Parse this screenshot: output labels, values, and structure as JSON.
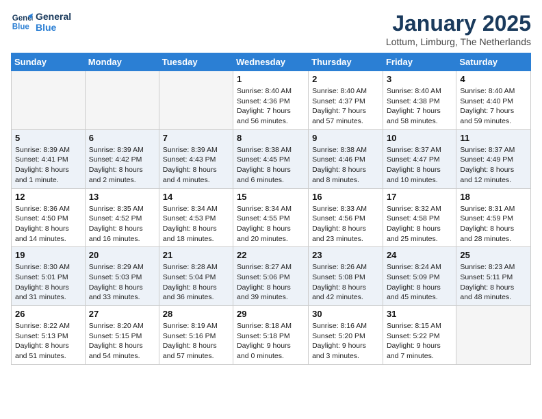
{
  "logo": {
    "line1": "General",
    "line2": "Blue"
  },
  "title": "January 2025",
  "subtitle": "Lottum, Limburg, The Netherlands",
  "weekdays": [
    "Sunday",
    "Monday",
    "Tuesday",
    "Wednesday",
    "Thursday",
    "Friday",
    "Saturday"
  ],
  "weeks": [
    [
      {
        "day": "",
        "info": ""
      },
      {
        "day": "",
        "info": ""
      },
      {
        "day": "",
        "info": ""
      },
      {
        "day": "1",
        "info": "Sunrise: 8:40 AM\nSunset: 4:36 PM\nDaylight: 7 hours\nand 56 minutes."
      },
      {
        "day": "2",
        "info": "Sunrise: 8:40 AM\nSunset: 4:37 PM\nDaylight: 7 hours\nand 57 minutes."
      },
      {
        "day": "3",
        "info": "Sunrise: 8:40 AM\nSunset: 4:38 PM\nDaylight: 7 hours\nand 58 minutes."
      },
      {
        "day": "4",
        "info": "Sunrise: 8:40 AM\nSunset: 4:40 PM\nDaylight: 7 hours\nand 59 minutes."
      }
    ],
    [
      {
        "day": "5",
        "info": "Sunrise: 8:39 AM\nSunset: 4:41 PM\nDaylight: 8 hours\nand 1 minute."
      },
      {
        "day": "6",
        "info": "Sunrise: 8:39 AM\nSunset: 4:42 PM\nDaylight: 8 hours\nand 2 minutes."
      },
      {
        "day": "7",
        "info": "Sunrise: 8:39 AM\nSunset: 4:43 PM\nDaylight: 8 hours\nand 4 minutes."
      },
      {
        "day": "8",
        "info": "Sunrise: 8:38 AM\nSunset: 4:45 PM\nDaylight: 8 hours\nand 6 minutes."
      },
      {
        "day": "9",
        "info": "Sunrise: 8:38 AM\nSunset: 4:46 PM\nDaylight: 8 hours\nand 8 minutes."
      },
      {
        "day": "10",
        "info": "Sunrise: 8:37 AM\nSunset: 4:47 PM\nDaylight: 8 hours\nand 10 minutes."
      },
      {
        "day": "11",
        "info": "Sunrise: 8:37 AM\nSunset: 4:49 PM\nDaylight: 8 hours\nand 12 minutes."
      }
    ],
    [
      {
        "day": "12",
        "info": "Sunrise: 8:36 AM\nSunset: 4:50 PM\nDaylight: 8 hours\nand 14 minutes."
      },
      {
        "day": "13",
        "info": "Sunrise: 8:35 AM\nSunset: 4:52 PM\nDaylight: 8 hours\nand 16 minutes."
      },
      {
        "day": "14",
        "info": "Sunrise: 8:34 AM\nSunset: 4:53 PM\nDaylight: 8 hours\nand 18 minutes."
      },
      {
        "day": "15",
        "info": "Sunrise: 8:34 AM\nSunset: 4:55 PM\nDaylight: 8 hours\nand 20 minutes."
      },
      {
        "day": "16",
        "info": "Sunrise: 8:33 AM\nSunset: 4:56 PM\nDaylight: 8 hours\nand 23 minutes."
      },
      {
        "day": "17",
        "info": "Sunrise: 8:32 AM\nSunset: 4:58 PM\nDaylight: 8 hours\nand 25 minutes."
      },
      {
        "day": "18",
        "info": "Sunrise: 8:31 AM\nSunset: 4:59 PM\nDaylight: 8 hours\nand 28 minutes."
      }
    ],
    [
      {
        "day": "19",
        "info": "Sunrise: 8:30 AM\nSunset: 5:01 PM\nDaylight: 8 hours\nand 31 minutes."
      },
      {
        "day": "20",
        "info": "Sunrise: 8:29 AM\nSunset: 5:03 PM\nDaylight: 8 hours\nand 33 minutes."
      },
      {
        "day": "21",
        "info": "Sunrise: 8:28 AM\nSunset: 5:04 PM\nDaylight: 8 hours\nand 36 minutes."
      },
      {
        "day": "22",
        "info": "Sunrise: 8:27 AM\nSunset: 5:06 PM\nDaylight: 8 hours\nand 39 minutes."
      },
      {
        "day": "23",
        "info": "Sunrise: 8:26 AM\nSunset: 5:08 PM\nDaylight: 8 hours\nand 42 minutes."
      },
      {
        "day": "24",
        "info": "Sunrise: 8:24 AM\nSunset: 5:09 PM\nDaylight: 8 hours\nand 45 minutes."
      },
      {
        "day": "25",
        "info": "Sunrise: 8:23 AM\nSunset: 5:11 PM\nDaylight: 8 hours\nand 48 minutes."
      }
    ],
    [
      {
        "day": "26",
        "info": "Sunrise: 8:22 AM\nSunset: 5:13 PM\nDaylight: 8 hours\nand 51 minutes."
      },
      {
        "day": "27",
        "info": "Sunrise: 8:20 AM\nSunset: 5:15 PM\nDaylight: 8 hours\nand 54 minutes."
      },
      {
        "day": "28",
        "info": "Sunrise: 8:19 AM\nSunset: 5:16 PM\nDaylight: 8 hours\nand 57 minutes."
      },
      {
        "day": "29",
        "info": "Sunrise: 8:18 AM\nSunset: 5:18 PM\nDaylight: 9 hours\nand 0 minutes."
      },
      {
        "day": "30",
        "info": "Sunrise: 8:16 AM\nSunset: 5:20 PM\nDaylight: 9 hours\nand 3 minutes."
      },
      {
        "day": "31",
        "info": "Sunrise: 8:15 AM\nSunset: 5:22 PM\nDaylight: 9 hours\nand 7 minutes."
      },
      {
        "day": "",
        "info": ""
      }
    ]
  ]
}
